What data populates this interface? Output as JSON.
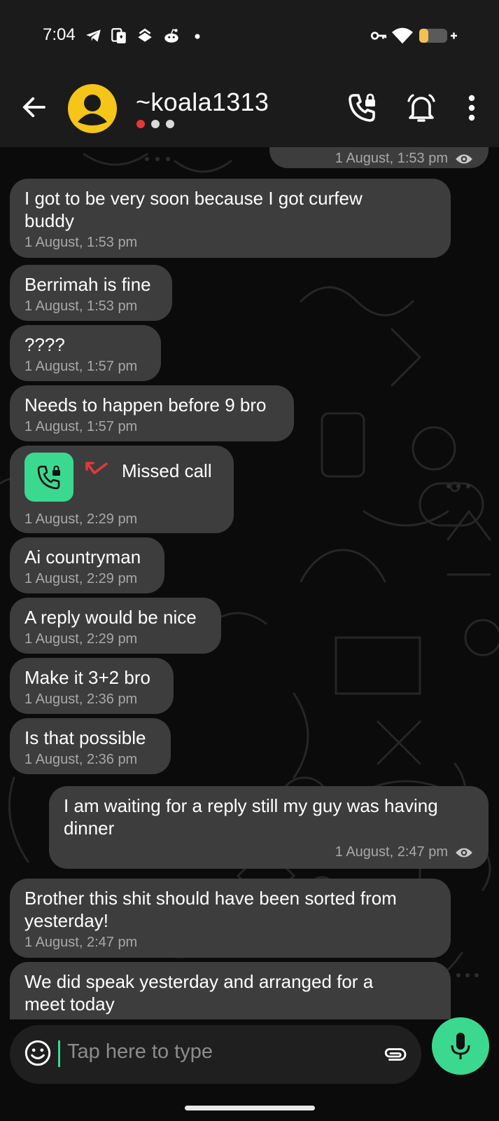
{
  "status_bar": {
    "time": "7:04",
    "icons": [
      "telegram-icon",
      "cards-icon",
      "stack-icon",
      "reddit-icon",
      "dot-icon"
    ],
    "right_icons": [
      "key-icon",
      "wifi-icon",
      "battery-charging-icon"
    ]
  },
  "header": {
    "contact_name": "~koala1313",
    "status_dots": [
      "#e53935",
      "#d9d9d9",
      "#d9d9d9"
    ],
    "actions": [
      "phone-lock-icon",
      "bell-icon",
      "more-vert-icon"
    ]
  },
  "messages": [
    {
      "dir": "out",
      "text": "",
      "time": "1 August, 1:53 pm",
      "seen": true
    },
    {
      "dir": "in",
      "text": "I got to be very soon because I got curfew\nbuddy",
      "time": "1 August, 1:53 pm"
    },
    {
      "dir": "in",
      "text": "Berrimah is fine",
      "time": "1 August, 1:53 pm"
    },
    {
      "dir": "in",
      "text": "????",
      "time": "1 August, 1:57 pm"
    },
    {
      "dir": "in",
      "text": "Needs to happen before 9 bro",
      "time": "1 August, 1:57 pm"
    },
    {
      "dir": "in",
      "type": "missed_call",
      "text": "Missed call",
      "time": "1 August, 2:29 pm"
    },
    {
      "dir": "in",
      "text": "Ai countryman",
      "time": "1 August, 2:29 pm"
    },
    {
      "dir": "in",
      "text": "A reply would be nice",
      "time": "1 August, 2:29 pm"
    },
    {
      "dir": "in",
      "text": "Make it 3+2 bro",
      "time": "1 August, 2:36 pm"
    },
    {
      "dir": "in",
      "text": "Is that possible",
      "time": "1 August, 2:36 pm"
    },
    {
      "dir": "out",
      "text": "I am waiting for a reply still my guy was having\ndinner",
      "time": "1 August, 2:47 pm",
      "seen": true
    },
    {
      "dir": "in",
      "text": "Brother this shit should have been sorted from\nyesterday!",
      "time": "1 August, 2:47 pm"
    },
    {
      "dir": "in",
      "text": "We did speak yesterday and arranged for a\nmeet today",
      "time": ""
    }
  ],
  "composer": {
    "placeholder": "Tap here to type",
    "accent": "#3ad98f"
  },
  "colors": {
    "bubble": "#3d3d3d",
    "header": "#1b1b1b",
    "missed_red": "#e53935"
  }
}
